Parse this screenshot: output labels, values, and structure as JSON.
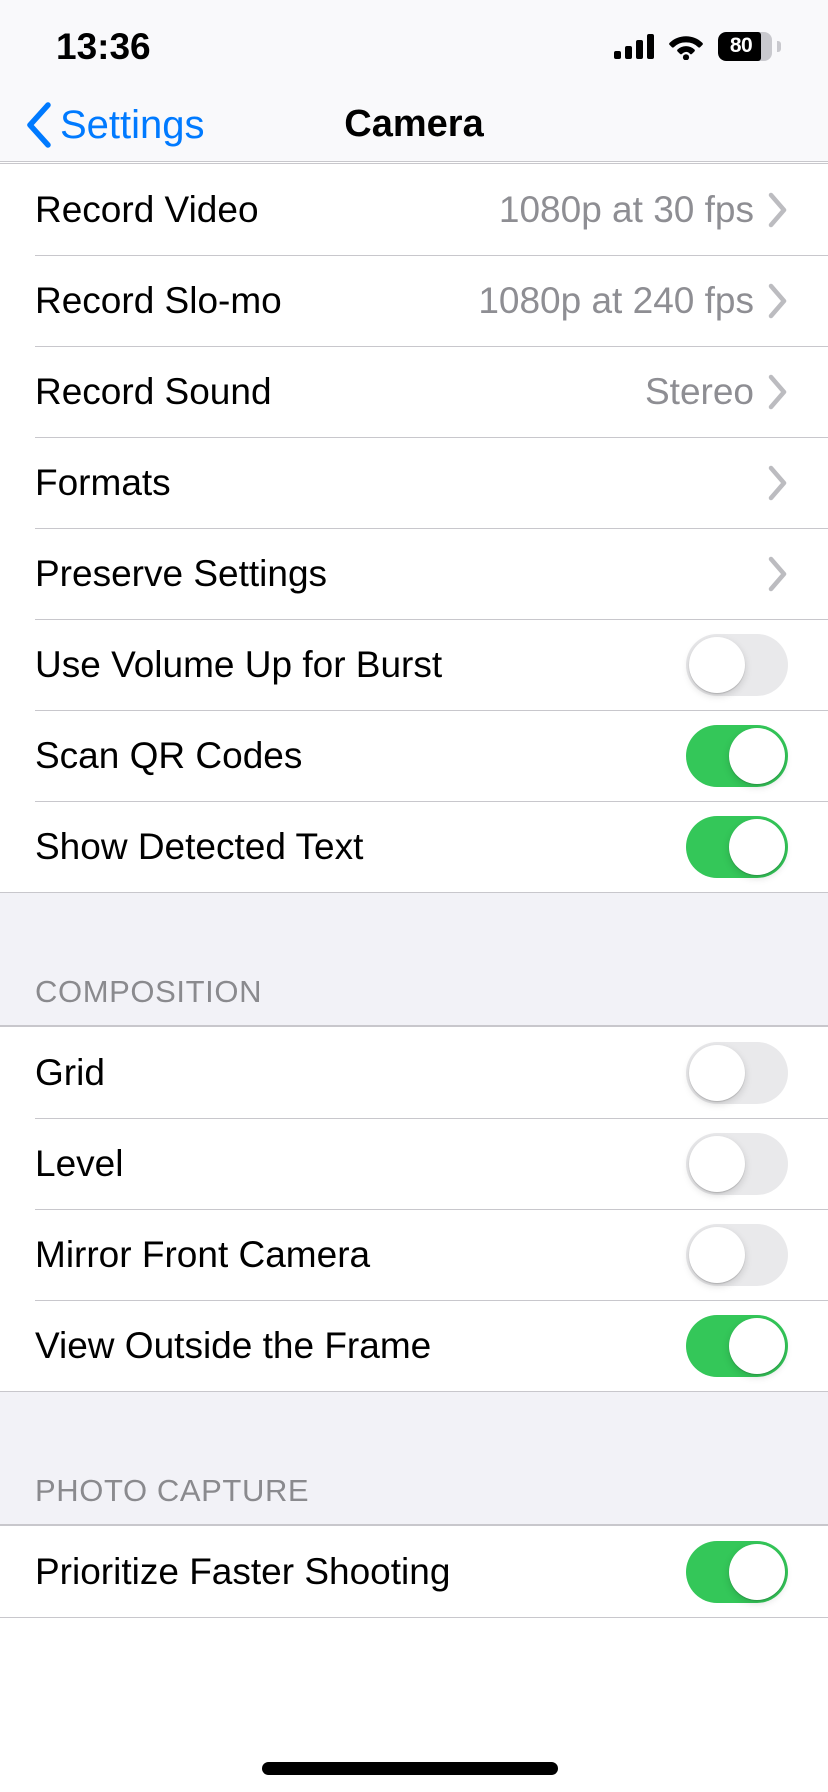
{
  "status_bar": {
    "time": "13:36",
    "signal_icon": "cellular-signal-icon",
    "signal_bars_total": 4,
    "signal_bars_filled": 4,
    "wifi_icon": "wifi-icon",
    "battery_icon": "battery-icon",
    "battery_percent_label": "80",
    "battery_percent": 80
  },
  "nav_bar": {
    "back_icon": "chevron-left-icon",
    "back_label": "Settings",
    "title": "Camera",
    "accent_color": "#007aff"
  },
  "colors": {
    "toggle_on": "#34c759",
    "toggle_off": "#e9e9eb",
    "group_background": "#f2f2f7",
    "separator": "#c8c7cc",
    "secondary_text": "#8e8e93",
    "header_text": "#8a8a8e"
  },
  "sections": [
    {
      "header": null,
      "rows": [
        {
          "label": "Record Video",
          "type": "disclosure",
          "value": "1080p at 30 fps",
          "icon": "chevron-right-icon"
        },
        {
          "label": "Record Slo-mo",
          "type": "disclosure",
          "value": "1080p at 240 fps",
          "icon": "chevron-right-icon"
        },
        {
          "label": "Record Sound",
          "type": "disclosure",
          "value": "Stereo",
          "icon": "chevron-right-icon"
        },
        {
          "label": "Formats",
          "type": "disclosure",
          "value": "",
          "icon": "chevron-right-icon"
        },
        {
          "label": "Preserve Settings",
          "type": "disclosure",
          "value": "",
          "icon": "chevron-right-icon"
        },
        {
          "label": "Use Volume Up for Burst",
          "type": "toggle",
          "on": false,
          "icon": "toggle-switch-icon"
        },
        {
          "label": "Scan QR Codes",
          "type": "toggle",
          "on": true,
          "icon": "toggle-switch-icon"
        },
        {
          "label": "Show Detected Text",
          "type": "toggle",
          "on": true,
          "icon": "toggle-switch-icon"
        }
      ]
    },
    {
      "header": "COMPOSITION",
      "rows": [
        {
          "label": "Grid",
          "type": "toggle",
          "on": false,
          "icon": "toggle-switch-icon"
        },
        {
          "label": "Level",
          "type": "toggle",
          "on": false,
          "icon": "toggle-switch-icon"
        },
        {
          "label": "Mirror Front Camera",
          "type": "toggle",
          "on": false,
          "icon": "toggle-switch-icon"
        },
        {
          "label": "View Outside the Frame",
          "type": "toggle",
          "on": true,
          "icon": "toggle-switch-icon"
        }
      ]
    },
    {
      "header": "PHOTO CAPTURE",
      "rows": [
        {
          "label": "Prioritize Faster Shooting",
          "type": "toggle",
          "on": true,
          "icon": "toggle-switch-icon"
        }
      ]
    }
  ],
  "home_indicator": {
    "icon": "home-indicator-bar"
  }
}
